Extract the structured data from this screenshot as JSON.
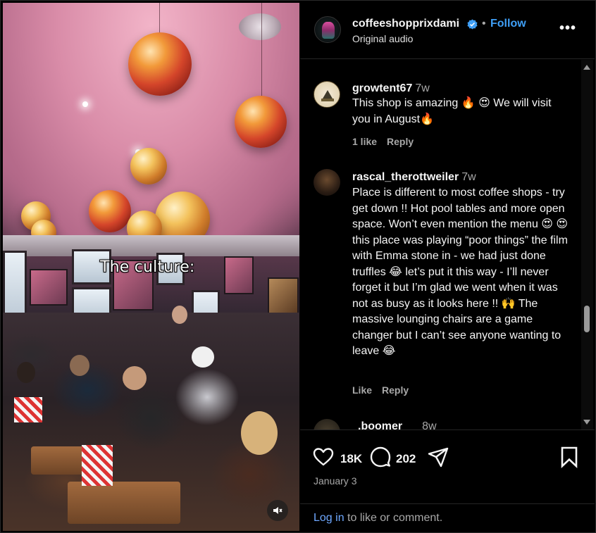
{
  "video": {
    "overlay_text": "The culture:",
    "sound_icon": "speaker-muted-icon"
  },
  "post": {
    "username": "coffeeshopprixdami",
    "verified": true,
    "follow_label": "Follow",
    "separator": "•",
    "audio": "Original audio",
    "more_icon": "more-horizontal-icon",
    "more_label": "•••"
  },
  "comments": [
    {
      "username": "growtent67",
      "time": "7w",
      "text": "This shop is amazing 🔥 😍 We will visit you in August🔥",
      "likes": "1 like",
      "reply": "Reply"
    },
    {
      "username": "rascal_therottweiler",
      "time": "7w",
      "text": "Place is different to most coffee shops - try get down !! Hot pool tables and more open space. Won’t even mention the menu 😍 😍 this place was playing “poor things” the film with Emma stone in - we had just done truffles 😂 let’s put it this way - I’ll never forget it but I’m glad we went when it was not as busy as it looks here !! 🙌 The massive lounging chairs are a game changer but I can’t see anyone wanting to leave 😂",
      "likes": "Like",
      "reply": "Reply"
    },
    {
      "username": ".boomer",
      "time": "8w"
    }
  ],
  "actions": {
    "like_count": "18K",
    "comment_count": "202",
    "date": "January 3"
  },
  "login": {
    "link": "Log in",
    "rest": " to like or comment."
  },
  "colors": {
    "link": "#3f9ff6",
    "muted": "#a8a8a8",
    "text": "#f5f5f5",
    "background": "#000000"
  }
}
